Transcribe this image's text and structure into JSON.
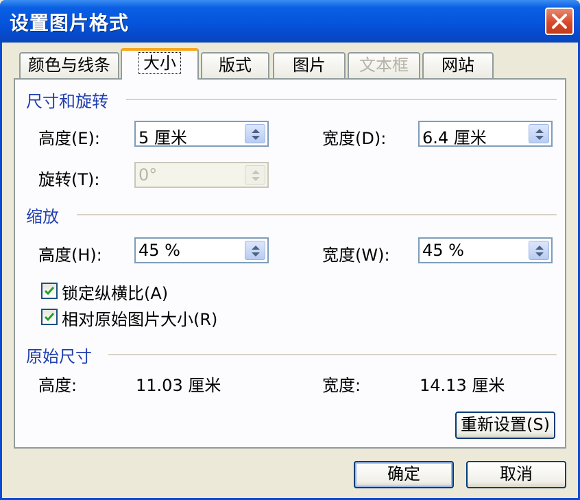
{
  "window": {
    "title": "设置图片格式"
  },
  "tabs": [
    {
      "label": "颜色与线条",
      "state": "normal"
    },
    {
      "label": "大小",
      "state": "active"
    },
    {
      "label": "版式",
      "state": "normal"
    },
    {
      "label": "图片",
      "state": "normal"
    },
    {
      "label": "文本框",
      "state": "disabled"
    },
    {
      "label": "网站",
      "state": "normal"
    }
  ],
  "size_rotate": {
    "title": "尺寸和旋转",
    "height_label": "高度(E):",
    "height_value": "5 厘米",
    "width_label": "宽度(D):",
    "width_value": "6.4 厘米",
    "rotate_label": "旋转(T):",
    "rotate_value": "0°"
  },
  "scale": {
    "title": "缩放",
    "height_label": "高度(H):",
    "height_value": "45 %",
    "width_label": "宽度(W):",
    "width_value": "45 %",
    "lock_aspect_label": "锁定纵横比(A)",
    "lock_aspect_checked": true,
    "relative_label": "相对原始图片大小(R)",
    "relative_checked": true
  },
  "original": {
    "title": "原始尺寸",
    "height_label": "高度:",
    "height_value": "11.03 厘米",
    "width_label": "宽度:",
    "width_value": "14.13 厘米",
    "reset_label": "重新设置(S)"
  },
  "footer": {
    "ok_label": "确定",
    "cancel_label": "取消"
  },
  "colors": {
    "title_bar": "#0554dc",
    "group_title": "#1f3fb0",
    "active_tab_accent": "#f5a623"
  }
}
